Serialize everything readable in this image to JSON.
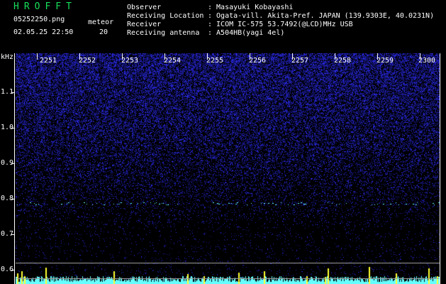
{
  "app_title": "HROFFT",
  "file": {
    "name": "05252250.png",
    "datetime": "02.05.25 22:50"
  },
  "meteor": {
    "label": "meteor",
    "count": "20"
  },
  "info": [
    {
      "label": "Observer",
      "value": ": Masayuki Kobayashi"
    },
    {
      "label": "Receiving Location",
      "value": ": Ogata-vill. Akita-Pref. JAPAN (139.9303E, 40.0231N)"
    },
    {
      "label": "Receiver",
      "value": ": ICOM IC-575 53.7492(@LCD)MHz USB"
    },
    {
      "label": "Receiving antenna",
      "value": ": A504HB(yagi 4el)"
    }
  ],
  "axis": {
    "unit": "kHz",
    "y_labels": [
      "1.1",
      "1.0",
      "0.9",
      "0.8",
      "0.7",
      "0.6"
    ],
    "x_labels": [
      "2251",
      "2252",
      "2253",
      "2254",
      "2255",
      "2256",
      "2257",
      "2258",
      "2259",
      "2300"
    ]
  },
  "colors": {
    "label_green": "#18e05a",
    "noise_blue": "#2a2aff",
    "background": "#000000",
    "echo_cyan": "#66ffff",
    "meteor_yellow": "#ffff30"
  }
}
